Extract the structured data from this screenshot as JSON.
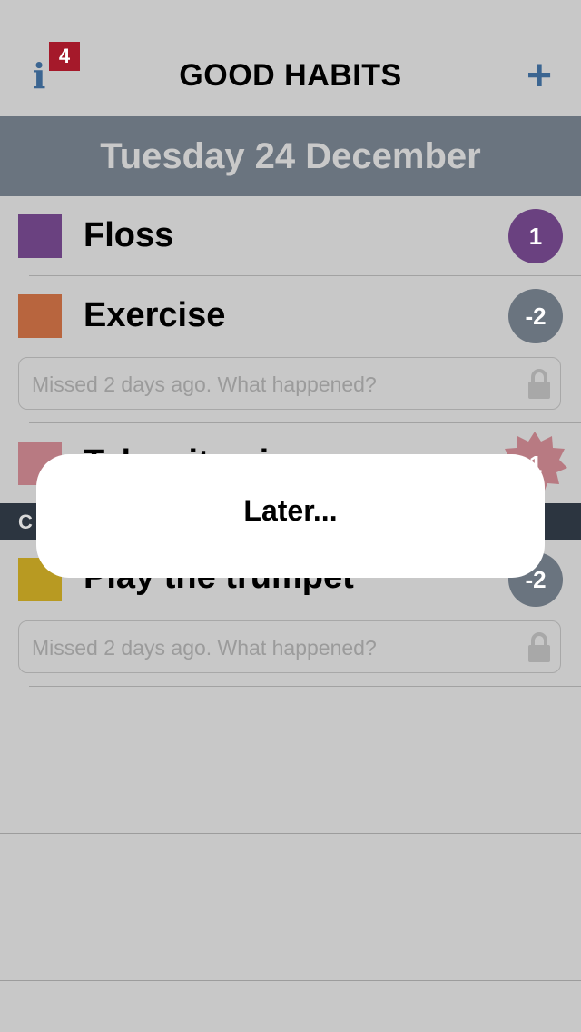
{
  "nav": {
    "title": "GOOD HABITS",
    "info_badge": "4",
    "info_glyph": "i",
    "add_glyph": "+"
  },
  "date_header": "Tuesday 24 December",
  "habits": [
    {
      "name": "Floss",
      "color": "#6a4180",
      "count": "1",
      "count_color": "#6a4180"
    },
    {
      "name": "Exercise",
      "color": "#b8653e",
      "count": "-2",
      "count_color": "#6a747f",
      "note_placeholder": "Missed 2 days ago. What happened?"
    },
    {
      "name": "Take vitamins",
      "color": "#b87a82",
      "count": "1",
      "count_color": "#b87a82"
    },
    {
      "name": "Play the trumpet",
      "color": "#b89a22",
      "count": "-2",
      "count_color": "#6a747f",
      "note_placeholder": "Missed 2 days ago. What happened?"
    }
  ],
  "category_label": "C",
  "popup": {
    "text": "Later..."
  },
  "colors": {
    "accent": "#3b6591",
    "badge": "#a5192a",
    "header": "#6a747f"
  },
  "icons": [
    "info-icon",
    "plus-icon",
    "lock-icon"
  ]
}
